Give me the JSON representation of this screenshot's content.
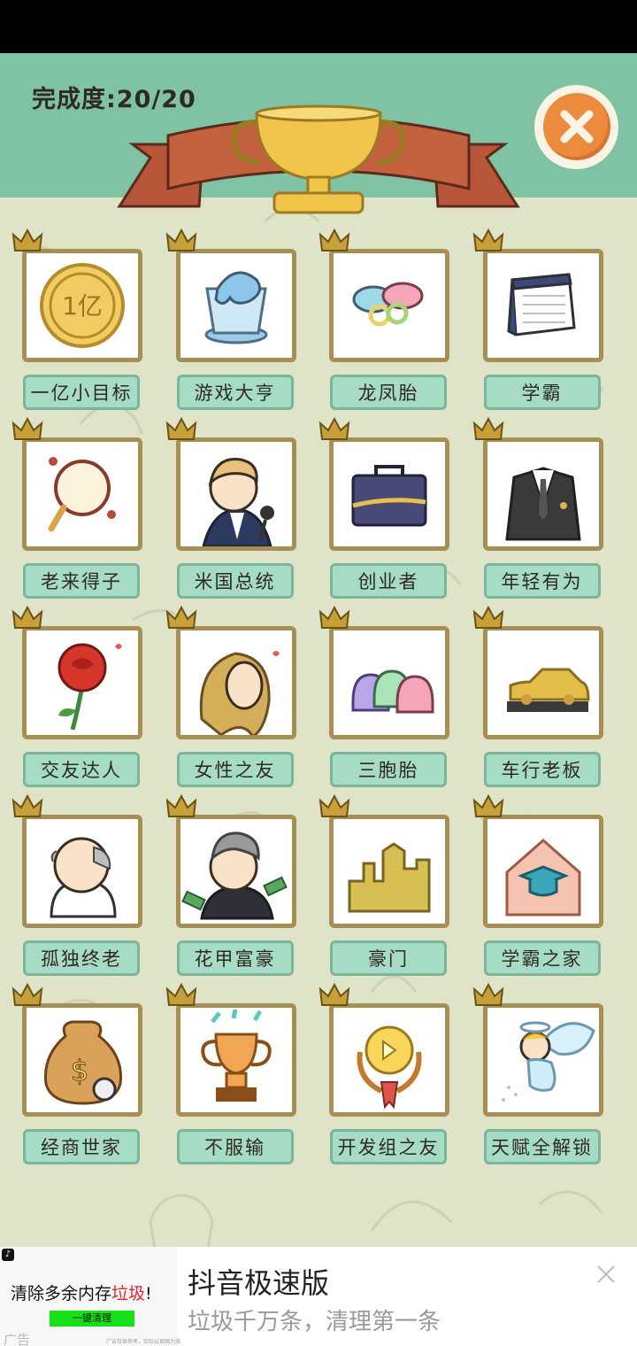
{
  "header": {
    "progress_label": "完成度:20/20"
  },
  "achievements": [
    {
      "label": "一亿小目标",
      "icon": "coin-icon"
    },
    {
      "label": "游戏大亨",
      "icon": "gamepad-trophy-icon"
    },
    {
      "label": "龙凤胎",
      "icon": "pacifiers-icon"
    },
    {
      "label": "学霸",
      "icon": "book-icon"
    },
    {
      "label": "老来得子",
      "icon": "rattle-drum-icon"
    },
    {
      "label": "米国总统",
      "icon": "president-icon"
    },
    {
      "label": "创业者",
      "icon": "briefcase-icon"
    },
    {
      "label": "年轻有为",
      "icon": "suit-icon"
    },
    {
      "label": "交友达人",
      "icon": "rose-icon"
    },
    {
      "label": "女性之友",
      "icon": "woman-icon"
    },
    {
      "label": "三胞胎",
      "icon": "baby-bottles-icon"
    },
    {
      "label": "车行老板",
      "icon": "car-icon"
    },
    {
      "label": "孤独终老",
      "icon": "old-man-icon"
    },
    {
      "label": "花甲富豪",
      "icon": "rich-old-man-icon"
    },
    {
      "label": "豪门",
      "icon": "castle-icon"
    },
    {
      "label": "学霸之家",
      "icon": "scholar-house-icon"
    },
    {
      "label": "经商世家",
      "icon": "money-bag-icon"
    },
    {
      "label": "不服输",
      "icon": "trophy-icon"
    },
    {
      "label": "开发组之友",
      "icon": "medal-icon"
    },
    {
      "label": "天赋全解锁",
      "icon": "angel-icon"
    }
  ],
  "coin_text": "1亿",
  "ad": {
    "logo": "♪",
    "slogan_prefix": "清除多余内存",
    "slogan_highlight": "垃圾",
    "slogan_suffix": "!",
    "button": "一键清理",
    "tag": "广告",
    "fine_print": "广告仅供参考，实际以官网为准",
    "title": "抖音极速版",
    "subtitle": "垃圾千万条，清理第一条"
  },
  "colors": {
    "header_bg": "#7fc3a4",
    "game_bg": "#dfe3c8",
    "card_border": "#a78f54",
    "label_bg": "#a6dbc4",
    "close_orange": "#ec8b3e",
    "ribbon": "#c4613f",
    "trophy_gold": "#f1c54a"
  }
}
